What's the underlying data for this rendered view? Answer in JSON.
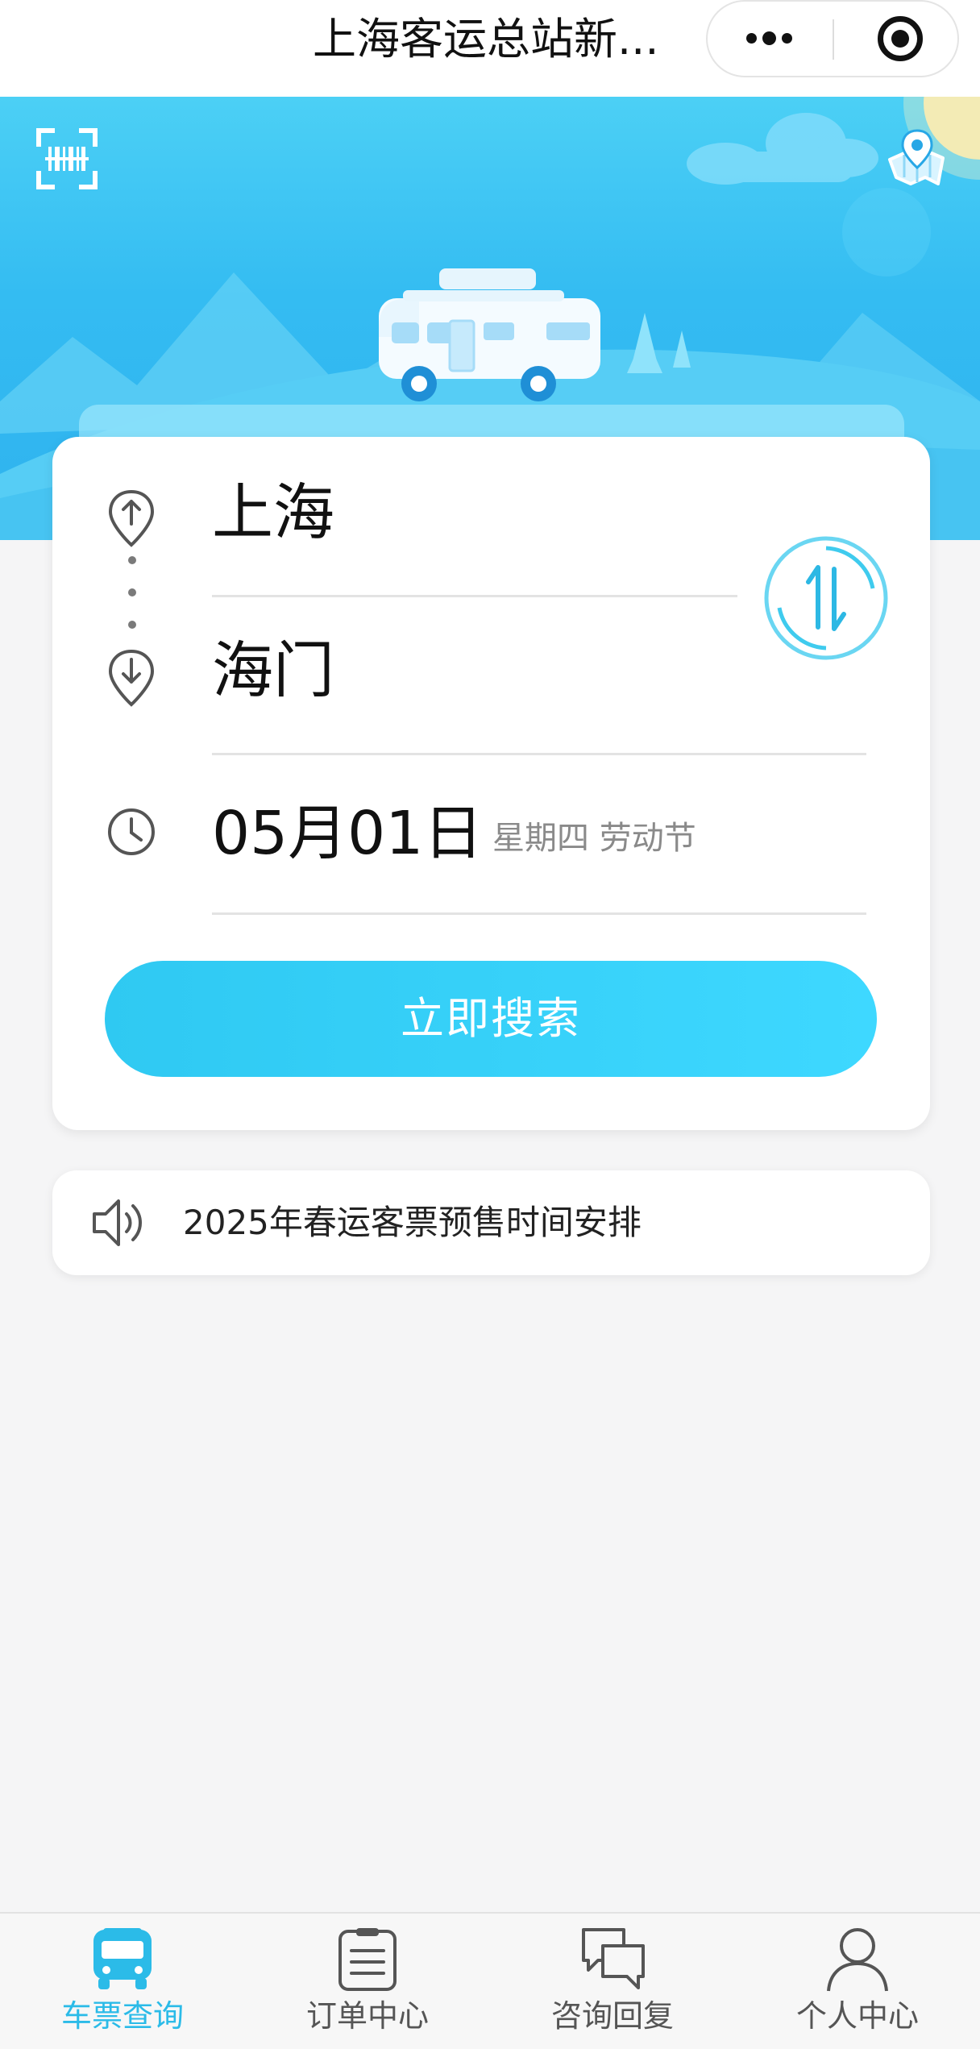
{
  "navbar": {
    "title": "上海客运总站新...",
    "more_icon": "more-dots-icon",
    "close_icon": "target-close-icon"
  },
  "banner": {
    "scan_icon": "scan-icon",
    "map_icon": "map-icon"
  },
  "search_card": {
    "from_city": "上海",
    "to_city": "海门",
    "date": "05月01日",
    "date_note": "星期四 劳动节",
    "search_label": "立即搜索",
    "swap_icon": "swap-icon"
  },
  "notice": {
    "text": "2025年春运客票预售时间安排",
    "icon": "speaker-icon"
  },
  "tabbar": {
    "tabs": [
      {
        "label": "车票查询",
        "icon": "bus-icon",
        "active": true
      },
      {
        "label": "订单中心",
        "icon": "clipboard-icon",
        "active": false
      },
      {
        "label": "咨询回复",
        "icon": "chat-icon",
        "active": false
      },
      {
        "label": "个人中心",
        "icon": "person-icon",
        "active": false
      }
    ]
  },
  "colors": {
    "accent": "#2bbbe8",
    "banner_top": "#4cd0f5",
    "banner_bottom": "#2fb2ee",
    "button": "#3ed8ff"
  }
}
